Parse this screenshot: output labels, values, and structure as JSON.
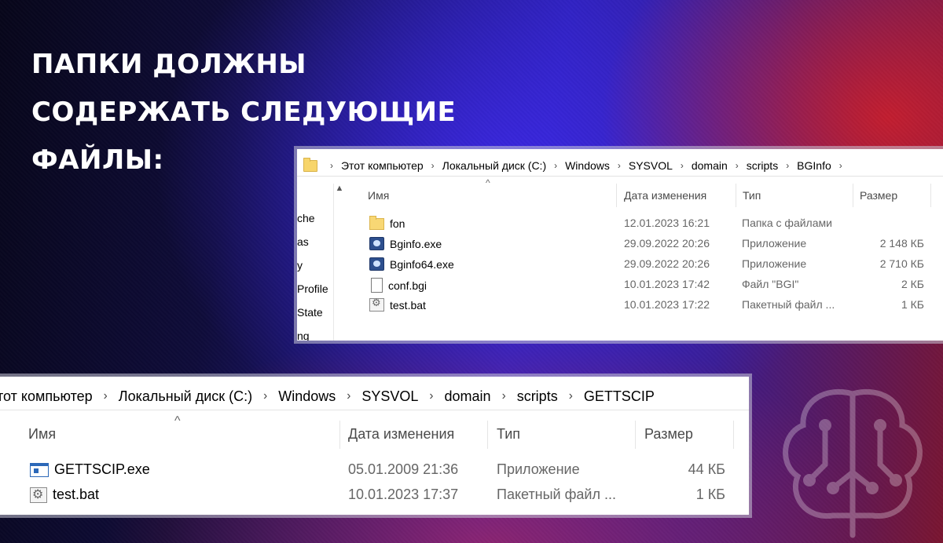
{
  "headline": {
    "lines": [
      "ПАПКИ ДОЛЖНЫ",
      "СОДЕРЖАТЬ СЛЕДУЮЩИЕ",
      "ФАЙЛЫ:"
    ]
  },
  "explorer_top": {
    "breadcrumb": [
      "Этот компьютер",
      "Локальный диск (C:)",
      "Windows",
      "SYSVOL",
      "domain",
      "scripts",
      "BGInfo"
    ],
    "sidebar_partial": [
      "che",
      "as",
      "y",
      "Profile",
      "State",
      "ng"
    ],
    "columns": {
      "name": "Имя",
      "date": "Дата изменения",
      "type": "Тип",
      "size": "Размер"
    },
    "files": [
      {
        "name": "fon",
        "date": "12.01.2023 16:21",
        "type": "Папка с файлами",
        "size": "",
        "icon": "folder-icon"
      },
      {
        "name": "Bginfo.exe",
        "date": "29.09.2022 20:26",
        "type": "Приложение",
        "size": "2 148 КБ",
        "icon": "bginfo-exe-icon"
      },
      {
        "name": "Bginfo64.exe",
        "date": "29.09.2022 20:26",
        "type": "Приложение",
        "size": "2 710 КБ",
        "icon": "bginfo-exe-icon"
      },
      {
        "name": "conf.bgi",
        "date": "10.01.2023 17:42",
        "type": "Файл \"BGI\"",
        "size": "2 КБ",
        "icon": "file-icon"
      },
      {
        "name": "test.bat",
        "date": "10.01.2023 17:22",
        "type": "Пакетный файл ...",
        "size": "1 КБ",
        "icon": "batch-file-icon"
      }
    ]
  },
  "explorer_bottom": {
    "breadcrumb": [
      "тот компьютер",
      "Локальный диск (C:)",
      "Windows",
      "SYSVOL",
      "domain",
      "scripts",
      "GETTSCIP"
    ],
    "columns": {
      "name": "Имя",
      "date": "Дата изменения",
      "type": "Тип",
      "size": "Размер"
    },
    "files": [
      {
        "name": "GETTSCIP.exe",
        "date": "05.01.2009 21:36",
        "type": "Приложение",
        "size": "44 КБ",
        "icon": "app-window-icon"
      },
      {
        "name": "test.bat",
        "date": "10.01.2023 17:37",
        "type": "Пакетный файл ...",
        "size": "1 КБ",
        "icon": "batch-file-icon"
      }
    ]
  },
  "colors": {
    "accent_red": "#c81e2d",
    "accent_blue": "#3c28e6",
    "background_dark": "#07061a"
  }
}
